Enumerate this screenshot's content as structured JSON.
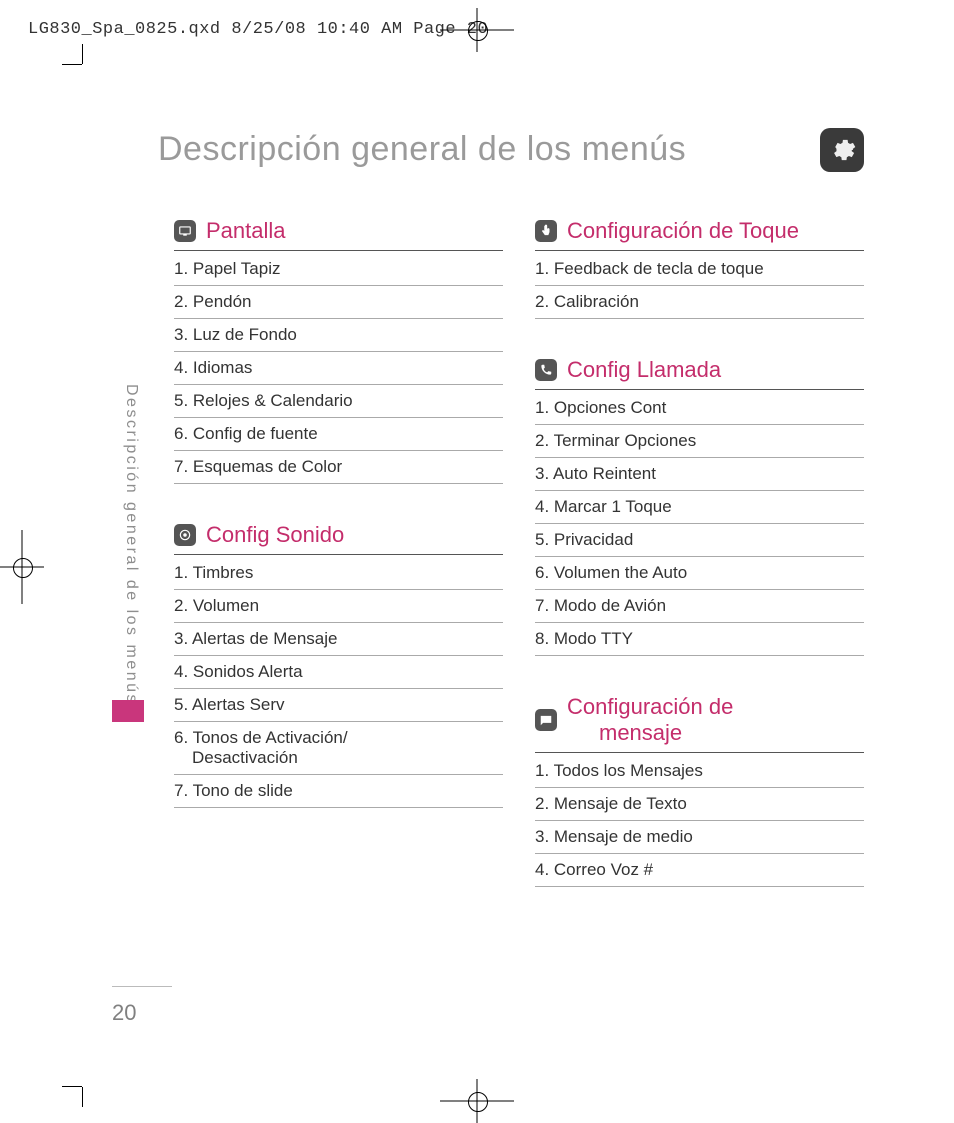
{
  "print_header": "LG830_Spa_0825.qxd  8/25/08  10:40 AM  Page 20",
  "page_title": "Descripción general de los menús",
  "side_label": "Descripción general de los menús",
  "page_number": "20",
  "left_sections": [
    {
      "icon": "display-icon",
      "title": "Pantalla",
      "items": [
        "1. Papel Tapiz",
        "2. Pendón",
        "3. Luz de Fondo",
        "4. Idiomas",
        "5. Relojes & Calendario",
        "6.  Config de fuente",
        "7.  Esquemas de Color"
      ]
    },
    {
      "icon": "sound-icon",
      "title": "Config Sonido",
      "items": [
        "1.  Timbres",
        "2.  Volumen",
        "3. Alertas de Mensaje",
        "4. Sonidos Alerta",
        "5. Alertas Serv",
        "6. Tonos de Activación/|Desactivación",
        "7. Tono de slide"
      ]
    }
  ],
  "right_sections": [
    {
      "icon": "touch-icon",
      "title": "Configuración de Toque",
      "items": [
        "1. Feedback de tecla de toque",
        "2. Calibración"
      ]
    },
    {
      "icon": "call-icon",
      "title": "Config Llamada",
      "items": [
        "1. Opciones Cont",
        "2. Terminar Opciones",
        "3. Auto Reintent",
        "4. Marcar 1 Toque",
        "5. Privacidad",
        "6. Volumen the Auto",
        "7. Modo de Avión",
        "8. Modo TTY"
      ]
    },
    {
      "icon": "message-icon",
      "title": "Configuración  de|mensaje",
      "items": [
        "1.  Todos los Mensajes",
        "2.  Mensaje de Texto",
        "3.  Mensaje de medio",
        "4.  Correo Voz #"
      ]
    }
  ]
}
